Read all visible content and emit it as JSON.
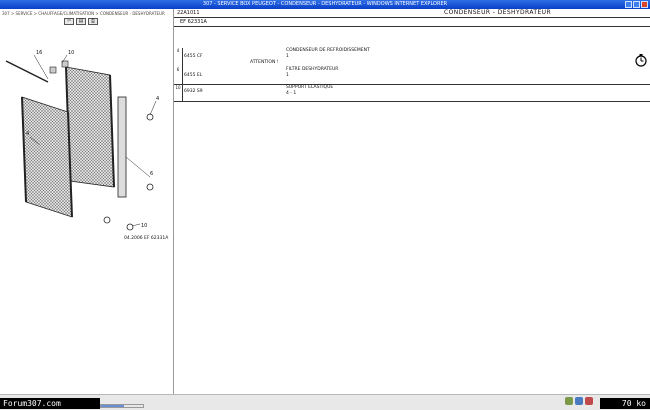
{
  "window": {
    "title": "307 - SERVICE BOX PEUGEOT - CONDENSEUR - DESHYDRATEUR - WINDOWS INTERNET EXPLORER"
  },
  "left_panel": {
    "breadcrumb": "307 > SERVICE > CHAUFFAGE/CLIMATISATION > CONDENSEUR - DESHYDRATEUR",
    "toolbar": [
      "⇦",
      "▤",
      "⎙"
    ],
    "diagram": {
      "callouts": [
        "16",
        "10",
        "4",
        "6",
        "4",
        "10"
      ],
      "ref_label": "04.2006 EF 62331A"
    }
  },
  "right_panel": {
    "part_code": "22A1011",
    "title": "CONDENSEUR - DESHYDRATEUR",
    "ref_code": "EF 62331A",
    "rows": [
      {
        "num": "4",
        "ref": "6455 CF",
        "lines": [
          "CONDENSEUR DE REFROIDISSEMENT",
          "ATTENTION !",
          "1"
        ]
      },
      {
        "num": "6",
        "ref": "6455 EL",
        "lines": [
          "FILTRE DESHYDRATEUR",
          "1"
        ]
      },
      {
        "num": "10",
        "ref": "6932 S9",
        "lines": [
          "SUPPORT ELASTIQUE",
          "4 - 1"
        ]
      }
    ]
  },
  "status": {
    "progress": 0.55,
    "watermark_left": "Forum307.com",
    "watermark_right": "70 ko"
  },
  "colors": {
    "titlebar": "#0a3fc9",
    "line": "#333333"
  }
}
